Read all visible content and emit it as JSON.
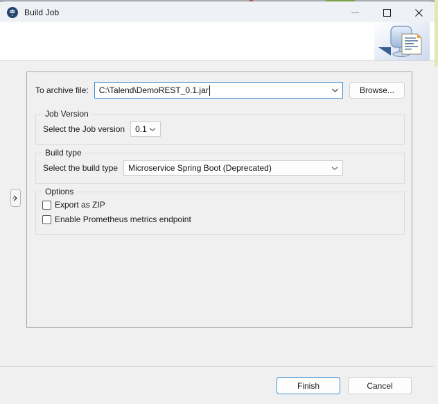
{
  "window": {
    "title": "Build Job",
    "app_icon": "talend-logo-icon",
    "controls": {
      "minimize": "minimize-icon",
      "maximize": "maximize-icon",
      "close": "close-icon"
    }
  },
  "banner": {
    "art": "export-document-icon"
  },
  "side_handle": {
    "icon": "chevron-right-icon"
  },
  "form": {
    "archive": {
      "label": "To archive file:",
      "value": "C:\\Talend\\DemoREST_0.1.jar",
      "placeholder": "",
      "browse_label": "Browse...",
      "dropdown_icon": "chevron-down-icon"
    },
    "job_version": {
      "group_title": "Job Version",
      "label": "Select the Job version",
      "value": "0.1",
      "options": [
        "0.1"
      ],
      "dropdown_icon": "chevron-down-icon"
    },
    "build_type": {
      "group_title": "Build type",
      "label": "Select the build type",
      "value": "Microservice Spring Boot (Deprecated)",
      "options": [
        "Microservice Spring Boot (Deprecated)"
      ],
      "dropdown_icon": "chevron-down-icon"
    },
    "options": {
      "group_title": "Options",
      "items": [
        {
          "label": "Export as ZIP",
          "checked": false
        },
        {
          "label": "Enable Prometheus metrics endpoint",
          "checked": false
        }
      ]
    }
  },
  "footer": {
    "finish_label": "Finish",
    "cancel_label": "Cancel"
  },
  "colors": {
    "accent": "#3f8fd0",
    "titlebar_bg": "#eef2f7",
    "body_bg": "#f0f0f0",
    "banner_bg": "#ffffff",
    "text": "#1a1a1a",
    "logo_blue": "#24456e"
  }
}
